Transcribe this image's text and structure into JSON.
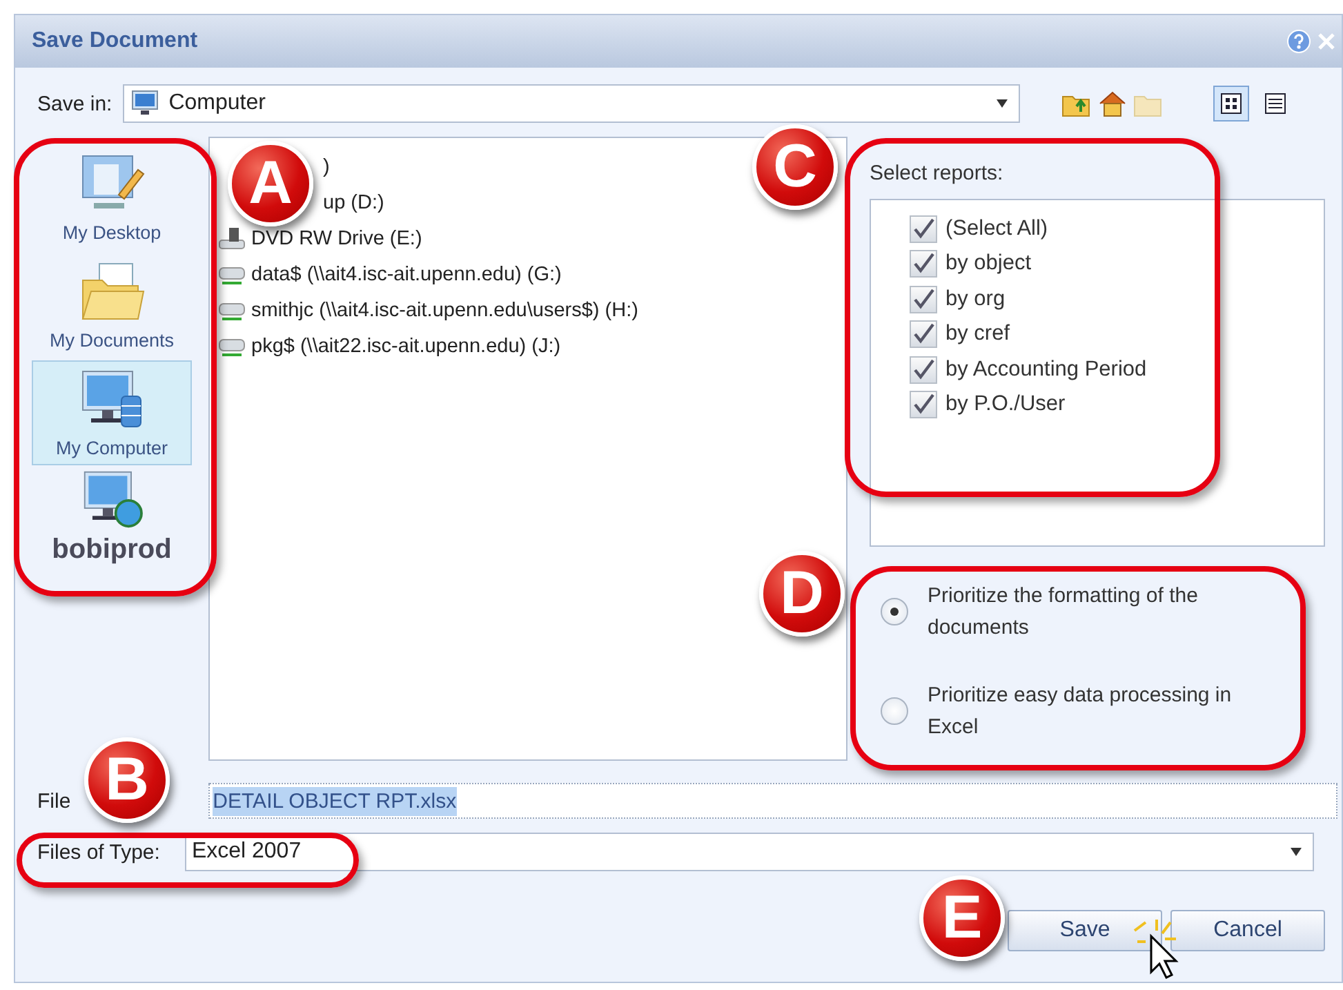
{
  "window": {
    "title": "Save Document"
  },
  "save_in": {
    "label": "Save in:",
    "value": "Computer"
  },
  "view_buttons": [
    {
      "kind": "icons",
      "selected": true
    },
    {
      "kind": "details",
      "selected": false
    }
  ],
  "places": [
    {
      "label": "My Desktop",
      "kind": "desktop",
      "selected": false
    },
    {
      "label": "My Documents",
      "kind": "documents",
      "selected": false
    },
    {
      "label": "My Computer",
      "kind": "computer",
      "selected": true
    },
    {
      "label": "bobiprod",
      "kind": "server",
      "selected": false
    }
  ],
  "files": [
    {
      "name": ")",
      "partial": true
    },
    {
      "name": "up (D:)",
      "partial": true
    },
    {
      "name": "DVD RW Drive (E:)",
      "kind": "dvd",
      "partial": false
    },
    {
      "name": "data$ (\\\\ait4.isc-ait.upenn.edu) (G:)",
      "kind": "network",
      "partial": false
    },
    {
      "name": "smithjc (\\\\ait4.isc-ait.upenn.edu\\users$) (H:)",
      "kind": "network",
      "partial": false
    },
    {
      "name": "pkg$ (\\\\ait22.isc-ait.upenn.edu) (J:)",
      "kind": "network",
      "partial": false
    }
  ],
  "reports": {
    "label": "Select reports:",
    "items": [
      {
        "label": "(Select All)",
        "checked": true
      },
      {
        "label": "by object",
        "checked": true
      },
      {
        "label": "by org",
        "checked": true
      },
      {
        "label": "by cref",
        "checked": true
      },
      {
        "label": "by Accounting Period",
        "checked": true
      },
      {
        "label": "by P.O./User",
        "checked": true
      }
    ]
  },
  "format_options": [
    {
      "label": "Prioritize the formatting of the documents",
      "selected": true
    },
    {
      "label": "Prioritize easy data processing in Excel",
      "selected": false
    }
  ],
  "file_name": {
    "label": "File",
    "value": "DETAIL OBJECT RPT.xlsx"
  },
  "file_type": {
    "label": "Files of Type:",
    "value": "Excel 2007"
  },
  "buttons": [
    "Save",
    "Cancel"
  ],
  "callouts": [
    {
      "letter": "A"
    },
    {
      "letter": "C"
    },
    {
      "letter": "D"
    },
    {
      "letter": "B"
    },
    {
      "letter": "E"
    }
  ]
}
